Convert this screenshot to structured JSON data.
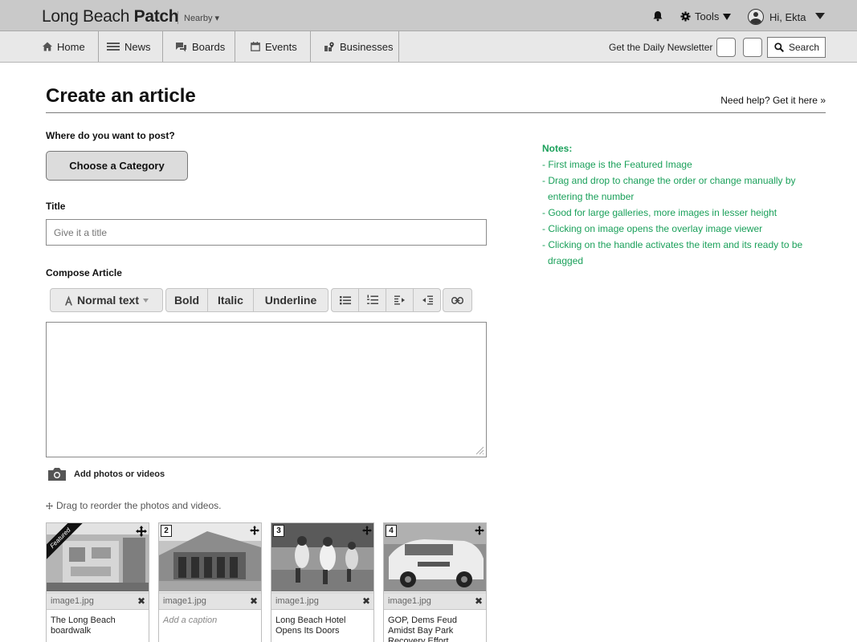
{
  "header": {
    "brand_light": "Long Beach ",
    "brand_bold": "Patch",
    "nearby": "Nearby ▾",
    "tools_label": "Tools",
    "user_greeting": "Hi, Ekta"
  },
  "nav": {
    "items": [
      {
        "label": "Home",
        "icon": "home-icon"
      },
      {
        "label": "News",
        "icon": "menu-lines-icon"
      },
      {
        "label": "Boards",
        "icon": "chat-bubbles-icon"
      },
      {
        "label": "Events",
        "icon": "calendar-icon"
      },
      {
        "label": "Businesses",
        "icon": "map-pin-icon"
      }
    ],
    "newsletter": "Get the Daily Newsletter",
    "search_label": "Search"
  },
  "page": {
    "title": "Create an article",
    "help_link": "Need help? Get it here »"
  },
  "form": {
    "category_question": "Where do you want to post?",
    "category_button": "Choose a Category",
    "title_label": "Title",
    "title_placeholder": "Give it a title",
    "compose_label": "Compose Article",
    "toolbar": {
      "text_style": "Normal text",
      "bold": "Bold",
      "italic": "Italic",
      "underline": "Underline"
    },
    "add_media": "Add photos or videos",
    "reorder_hint": "Drag to reorder the photos and videos."
  },
  "gallery": [
    {
      "num": "",
      "featured": "Featured",
      "file": "image1.jpg",
      "caption": "The Long Beach boardwalk",
      "placeholder": false
    },
    {
      "num": "2",
      "featured": "",
      "file": "image1.jpg",
      "caption": "Add a caption",
      "placeholder": true
    },
    {
      "num": "3",
      "featured": "",
      "file": "image1.jpg",
      "caption": "Long Beach Hotel Opens Its Doors",
      "placeholder": false
    },
    {
      "num": "4",
      "featured": "",
      "file": "image1.jpg",
      "caption": "GOP, Dems Feud Amidst Bay Park Recovery Effort Outlines",
      "placeholder": false
    }
  ],
  "notes": {
    "title": "Notes:",
    "items": [
      "- First image is the Featured Image",
      "- Drag and drop to change the order or change manually by entering the number",
      "- Good for large galleries, more images in lesser height",
      "- Clicking on image opens the overlay image viewer",
      "- Clicking on the handle activates the item and its ready to be dragged"
    ]
  },
  "colors": {
    "notes_text": "#1aa05a",
    "topbar_bg": "#c9c9c9",
    "navbar_bg": "#e8e8e8"
  }
}
